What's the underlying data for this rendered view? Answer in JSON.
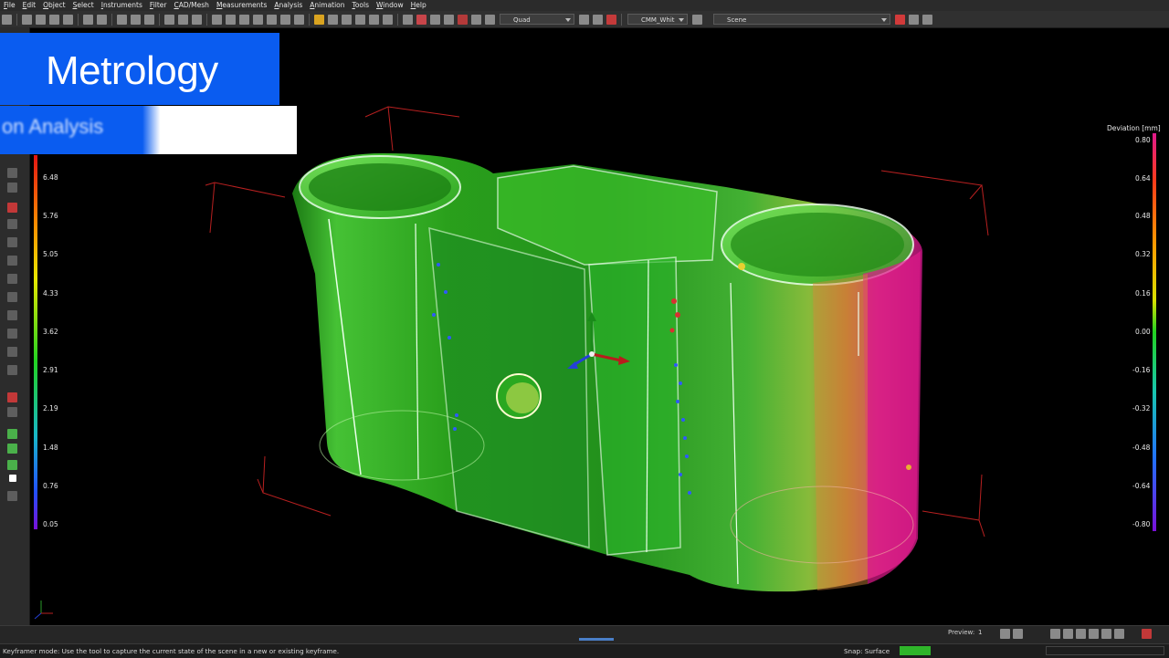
{
  "menu": [
    "File",
    "Edit",
    "Object",
    "Select",
    "Instruments",
    "Filter",
    "CAD/Mesh",
    "Measurements",
    "Analysis",
    "Animation",
    "Tools",
    "Window",
    "Help"
  ],
  "toolbar": {
    "view_mode": "Quad",
    "style": "CMM_Whit",
    "scene": "Scene"
  },
  "overlay": {
    "title": "Metrology",
    "subtitle": "on Analysis"
  },
  "left_scale": {
    "labels": [
      "6.48",
      "5.76",
      "5.05",
      "4.33",
      "3.62",
      "2.91",
      "2.19",
      "1.48",
      "0.76",
      "0.05"
    ]
  },
  "right_scale": {
    "title": "Deviation [mm]",
    "labels": [
      "0.80",
      "0.64",
      "0.48",
      "0.32",
      "0.16",
      "0.00",
      "-0.16",
      "-0.32",
      "-0.48",
      "-0.64",
      "-0.80"
    ]
  },
  "bottom": {
    "preview_label": "Preview:",
    "preview_value": "1"
  },
  "status": {
    "message": "Keyframer mode: Use the tool to capture the current state of the scene in a new or existing keyframe.",
    "snap": "Snap: Surface"
  },
  "colors": {
    "banner": "#0a5cf0",
    "ui_dark": "#2b2b2b",
    "part_green": "#3fc832",
    "deviation_high": "#e0198c"
  }
}
